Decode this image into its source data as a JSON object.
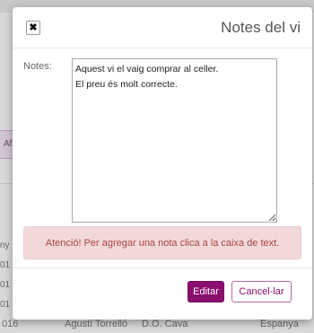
{
  "background": {
    "tab_label": "Af",
    "edge_chars": [
      "ny",
      "01",
      "01",
      "01"
    ],
    "row": [
      "016",
      "Agustí Torrelló",
      "D.O. Cava",
      "Espanya"
    ]
  },
  "modal": {
    "title": "Notes del vi",
    "close_label": "✖",
    "notes_label": "Notes:",
    "notes_lines": [
      "Aquest vi el vaig comprar al celler.",
      "El preu és molt correcte."
    ],
    "alert_text": "Atenció! Per agregar una nota clica a la caixa de text.",
    "edit_button": "Editar",
    "cancel_button": "Cancel·lar"
  },
  "colors": {
    "primary": "#8b0f6e",
    "alert_bg": "#f2d9d9",
    "alert_text": "#a94442"
  }
}
